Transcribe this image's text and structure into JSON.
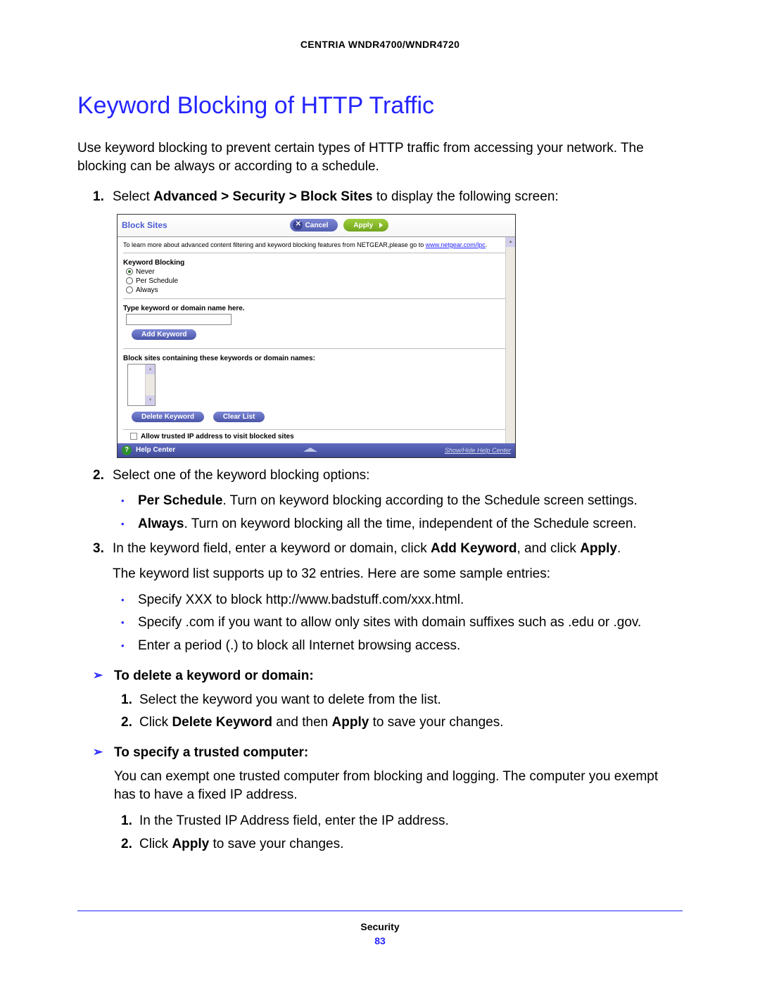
{
  "doc_header": "CENTRIA WNDR4700/WNDR4720",
  "h1": "Keyword Blocking of HTTP Traffic",
  "intro": "Use keyword blocking to prevent certain types of HTTP traffic from accessing your network. The blocking can be always or according to a schedule.",
  "step1": {
    "num": "1.",
    "pre": "Select ",
    "bold": "Advanced > Security > Block Sites",
    "post": " to display the following screen:"
  },
  "screenshot": {
    "title": "Block Sites",
    "cancel": "Cancel",
    "apply": "Apply",
    "info_pre": "To learn more about advanced content filtering and keyword blocking features from NETGEAR,please go to ",
    "info_link": "www.netgear.com/lpc",
    "info_post": ".",
    "kw_label": "Keyword Blocking",
    "r1": "Never",
    "r2": "Per Schedule",
    "r3": "Always",
    "type_label": "Type keyword or domain name here.",
    "add_btn": "Add Keyword",
    "list_label": "Block sites containing these keywords or domain names:",
    "del_btn": "Delete Keyword",
    "clear_btn": "Clear List",
    "allow": "Allow trusted IP address to visit blocked sites",
    "help": "Help Center",
    "help_link": "Show/Hide Help Center"
  },
  "step2": {
    "num": "2.",
    "txt": "Select one of the keyword blocking options:",
    "b1_bold": "Per Schedule",
    "b1_rest": ". Turn on keyword blocking according to the Schedule screen settings.",
    "b2_bold": "Always",
    "b2_rest": ". Turn on keyword blocking all the time, independent of the Schedule screen."
  },
  "step3": {
    "num": "3.",
    "pre": "In the keyword field, enter a keyword or domain, click ",
    "b1": "Add Keyword",
    "mid": ", and click ",
    "b2": "Apply",
    "post": ".",
    "sub": "The keyword list supports up to 32 entries. Here are some sample entries:",
    "bul1": "Specify XXX to block http://www.badstuff.com/xxx.html.",
    "bul2": "Specify .com if you want to allow only sites with domain suffixes such as .edu or .gov.",
    "bul3": "Enter a period (.) to block all Internet browsing access."
  },
  "sec_del": {
    "title": "To delete a keyword or domain:",
    "s1": {
      "num": "1.",
      "txt": "Select the keyword you want to delete from the list."
    },
    "s2": {
      "num": "2.",
      "pre": "Click ",
      "b1": "Delete Keyword",
      "mid": " and then ",
      "b2": "Apply",
      "post": " to save your changes."
    }
  },
  "sec_trust": {
    "title": "To specify a trusted computer:",
    "intro": "You can exempt one trusted computer from blocking and logging. The computer you exempt has to have a fixed IP address.",
    "s1": {
      "num": "1.",
      "txt": "In the Trusted IP Address field, enter the IP address."
    },
    "s2": {
      "num": "2.",
      "pre": "Click ",
      "b1": "Apply",
      "post": " to save your changes."
    }
  },
  "footer": {
    "section": "Security",
    "page": "83"
  }
}
